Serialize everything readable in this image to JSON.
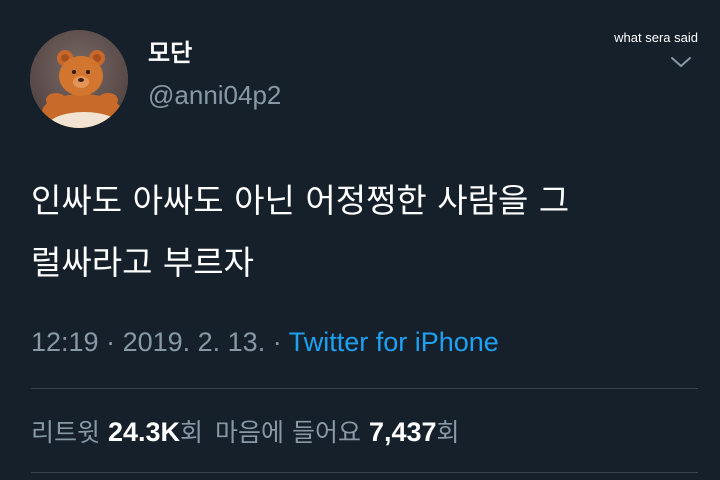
{
  "watermark": "what sera said",
  "user": {
    "display_name": "모단",
    "handle": "@anni04p2"
  },
  "tweet": {
    "line1": "인싸도 아싸도 아닌 어정쩡한 사람을 그",
    "line2": "럴싸라고 부르자"
  },
  "meta": {
    "time": "12:19",
    "sep1": " · ",
    "date": "2019. 2. 13.",
    "sep2": " · ",
    "source": "Twitter for iPhone"
  },
  "stats": {
    "retweets_label": "리트윗",
    "retweets_value": "24.3K",
    "retweets_unit": "회",
    "likes_label": "마음에 들어요",
    "likes_value": "7,437",
    "likes_unit": "회"
  },
  "icons": {
    "more": "chevron-down-icon",
    "avatar": "teddy-bear-avatar"
  },
  "colors": {
    "background": "#15202b",
    "secondary_text": "#8899a6",
    "link": "#1da1f2",
    "divider": "#38444d"
  }
}
